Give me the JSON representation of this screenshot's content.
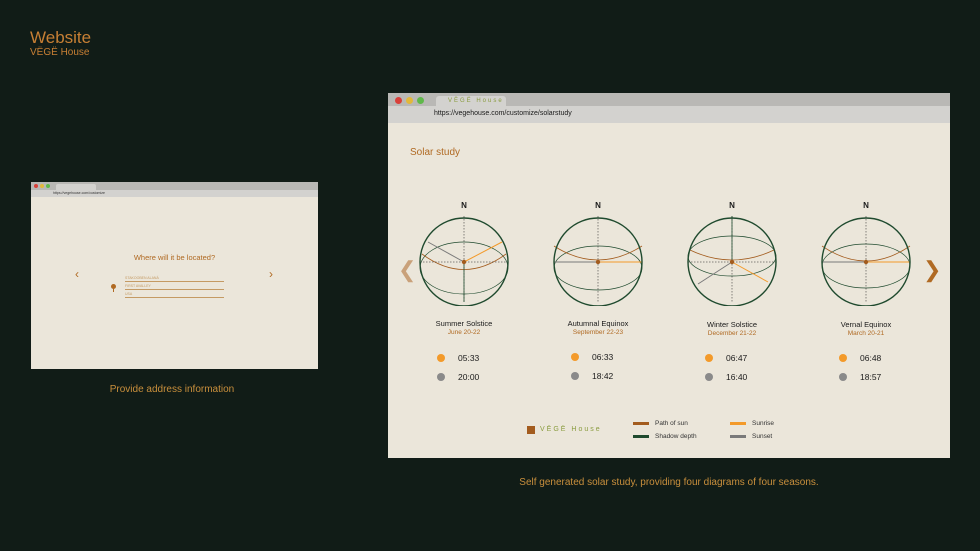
{
  "header": {
    "title": "Website",
    "subtitle": "VËGË House"
  },
  "small_browser": {
    "url": "https://vegehouse.com/customize",
    "question": "Where will it be located?",
    "fields": [
      "STAKOOBEN ALANÁ",
      "FIRST AVALLEY",
      "USA"
    ],
    "caption": "Provide address information"
  },
  "large_browser": {
    "tab_title": "VËGË House",
    "url": "https://vegehouse.com/customize/solarstudy",
    "heading": "Solar study",
    "north_label": "N",
    "seasons": [
      {
        "name": "Summer Solstice",
        "date": "June 20-22",
        "sunrise": "05:33",
        "sunset": "20:00"
      },
      {
        "name": "Autumnal Equinox",
        "date": "September 22-23",
        "sunrise": "06:33",
        "sunset": "18:42"
      },
      {
        "name": "Winter Solstice",
        "date": "December 21-22",
        "sunrise": "06:47",
        "sunset": "16:40"
      },
      {
        "name": "Vernal Equinox",
        "date": "March 20-21",
        "sunrise": "06:48",
        "sunset": "18:57"
      }
    ],
    "legend": {
      "brand": "VËGË House",
      "items": [
        {
          "label": "Path of sun",
          "color": "#a35c1e"
        },
        {
          "label": "Sunrise",
          "color": "#f39a2a"
        },
        {
          "label": "Shadow depth",
          "color": "#1f4a2e"
        },
        {
          "label": "Sunset",
          "color": "#7a7a7a"
        }
      ]
    },
    "caption": "Self generated solar study, providing four diagrams of four seasons."
  },
  "colors": {
    "background": "#111c17",
    "accent": "#c77f34",
    "panel": "#ebe6da",
    "sunrise": "#f39a2a",
    "sunset": "#8a8a8a"
  },
  "icons": {
    "prev": "chevron-left-icon",
    "next": "chevron-right-icon",
    "pin": "map-pin-icon"
  }
}
